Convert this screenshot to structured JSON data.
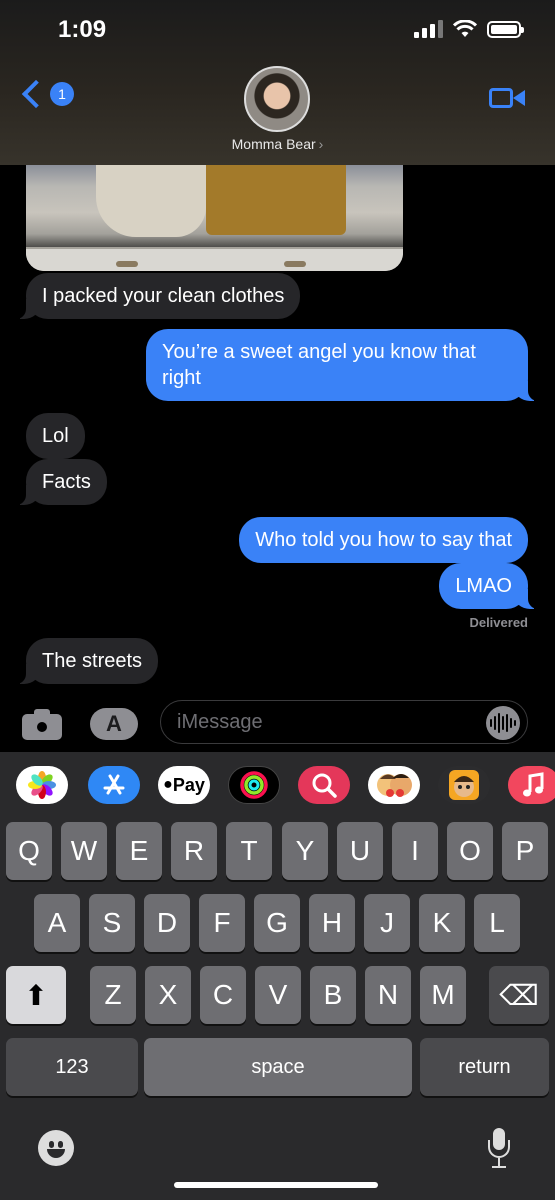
{
  "status": {
    "time": "1:09"
  },
  "header": {
    "back_badge": "1",
    "contact_name": "Momma Bear",
    "chevron": "›"
  },
  "messages": {
    "m1": "I packed your clean clothes",
    "m2": "You’re a sweet angel you know that right",
    "m3": "Lol",
    "m4": "Facts",
    "m5": "Who told you how to say that",
    "m6": "LMAO",
    "delivered": "Delivered",
    "m7": "The streets"
  },
  "input": {
    "placeholder": "iMessage",
    "appstore_glyph": "A"
  },
  "app_drawer": {
    "pay_label": "Pay",
    "icons": [
      "photos-icon",
      "app-store-icon",
      "apple-pay-icon",
      "activity-icon",
      "search-images-icon",
      "memoji-stickers-icon",
      "memoji-icon",
      "music-icon"
    ]
  },
  "keyboard": {
    "row1": [
      "Q",
      "W",
      "E",
      "R",
      "T",
      "Y",
      "U",
      "I",
      "O",
      "P"
    ],
    "row2": [
      "A",
      "S",
      "D",
      "F",
      "G",
      "H",
      "J",
      "K",
      "L"
    ],
    "row3": [
      "Z",
      "X",
      "C",
      "V",
      "B",
      "N",
      "M"
    ],
    "numbers": "123",
    "space": "space",
    "return": "return",
    "shift_glyph": "⬆",
    "delete_glyph": "⌫"
  },
  "colors": {
    "sent_bubble": "#3a82f7",
    "received_bubble": "#262629",
    "accent": "#3a82f7"
  }
}
